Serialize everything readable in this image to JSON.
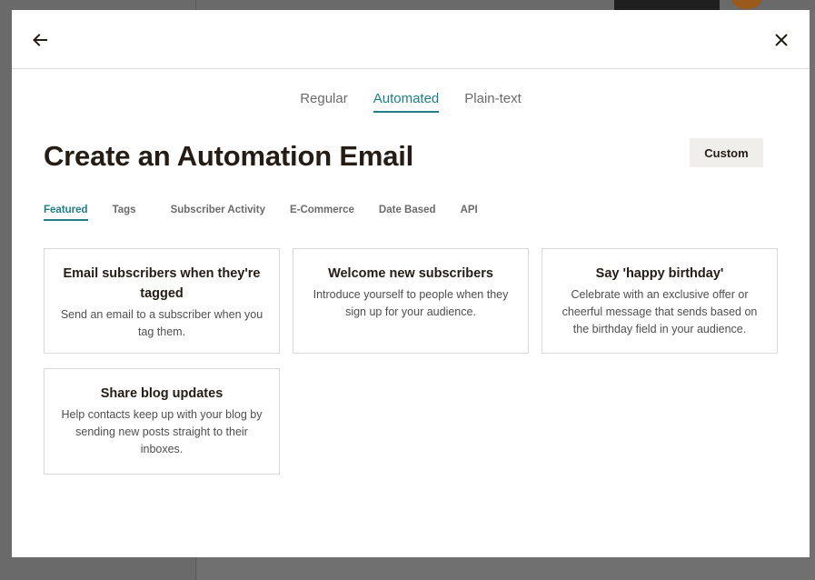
{
  "modal": {
    "type_tabs": [
      "Regular",
      "Automated",
      "Plain-text"
    ],
    "active_type_tab": "Automated",
    "title": "Create an Automation Email",
    "custom_label": "Custom",
    "category_tabs": [
      "Featured",
      "Tags",
      "Subscriber Activity",
      "E-Commerce",
      "Date Based",
      "API"
    ],
    "active_category_tab": "Featured",
    "cards": [
      {
        "title": "Email subscribers when they're tagged",
        "description": "Send an email to a subscriber when you tag them."
      },
      {
        "title": "Welcome new subscribers",
        "description": "Introduce yourself to people when they sign up for your audience."
      },
      {
        "title": "Say 'happy birthday'",
        "description": "Celebrate with an exclusive offer or cheerful message that sends based on the birthday field in your audience."
      },
      {
        "title": "Share blog updates",
        "description": "Help contacts keep up with your blog by sending new posts straight to their inboxes."
      }
    ]
  },
  "icons": {
    "back": "arrow-left-icon",
    "close": "close-icon"
  },
  "colors": {
    "accent": "#207e88",
    "text": "#241c15",
    "button_bg": "#efeeea"
  }
}
